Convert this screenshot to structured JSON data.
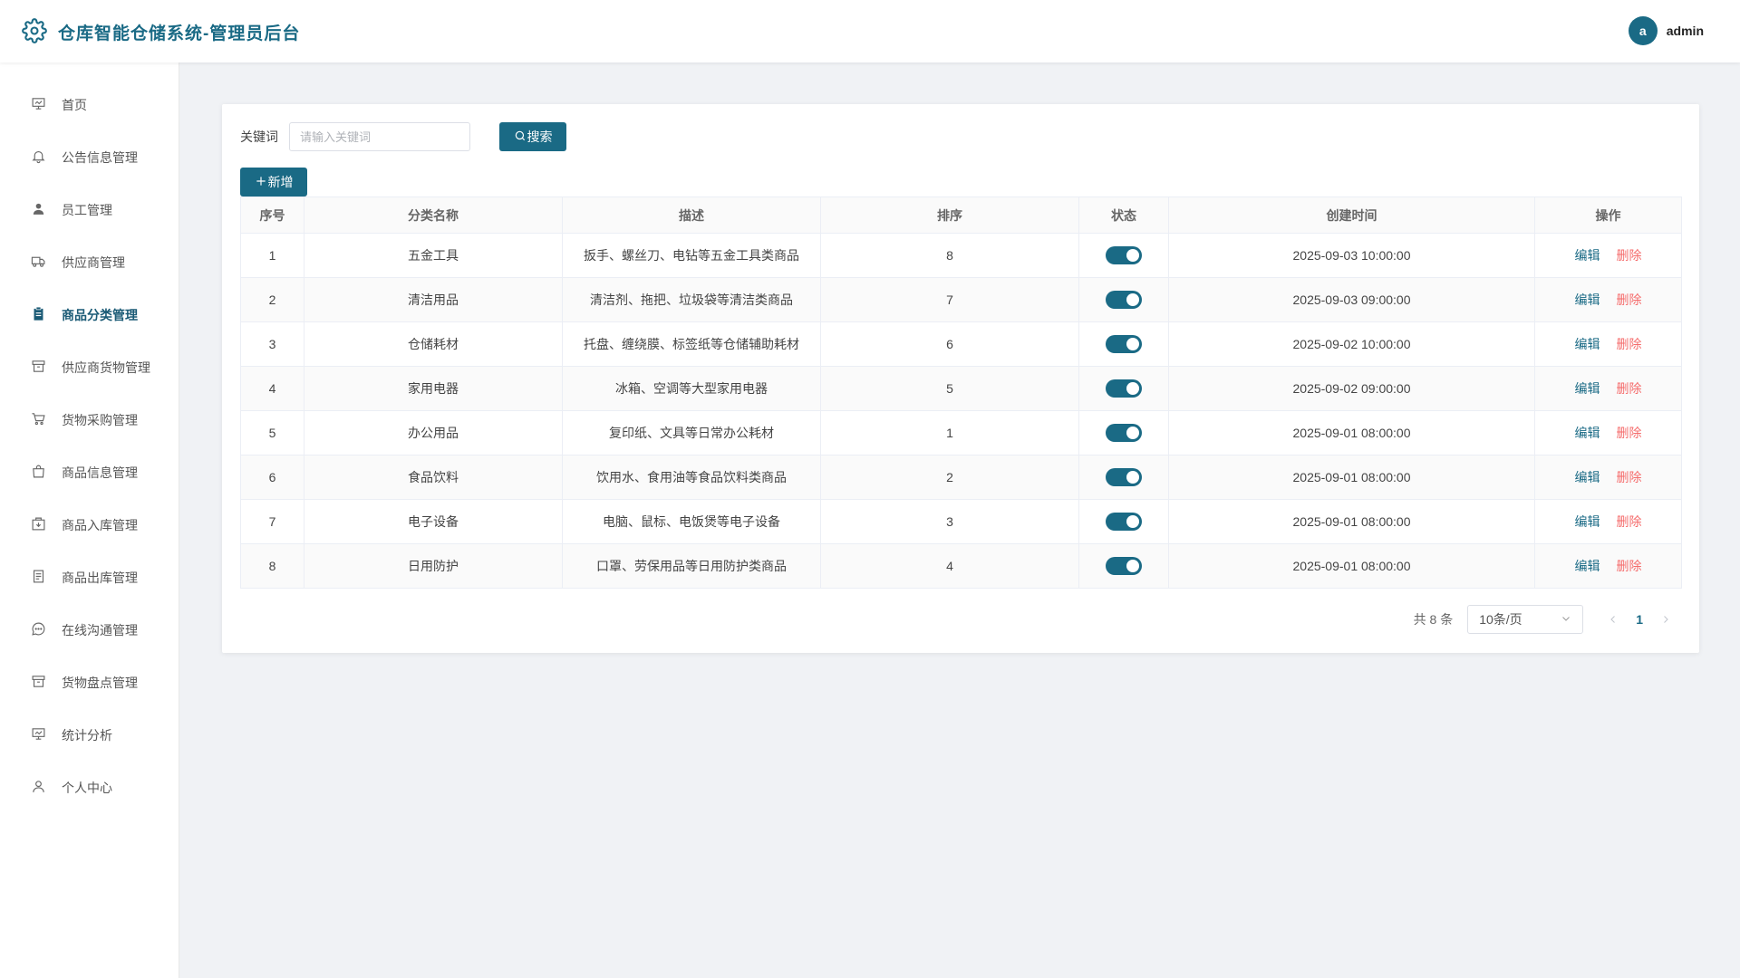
{
  "app": {
    "title": "仓库智能仓储系统-管理员后台",
    "accent": "#1a6a85"
  },
  "user": {
    "avatar_letter": "a",
    "name": "admin"
  },
  "sidebar": {
    "items": [
      {
        "label": "首页",
        "icon": "dashboard-icon",
        "active": false
      },
      {
        "label": "公告信息管理",
        "icon": "bell-icon",
        "active": false
      },
      {
        "label": "员工管理",
        "icon": "user-icon",
        "active": false
      },
      {
        "label": "供应商管理",
        "icon": "truck-icon",
        "active": false
      },
      {
        "label": "商品分类管理",
        "icon": "clipboard-icon",
        "active": true
      },
      {
        "label": "供应商货物管理",
        "icon": "box-icon",
        "active": false
      },
      {
        "label": "货物采购管理",
        "icon": "cart-icon",
        "active": false
      },
      {
        "label": "商品信息管理",
        "icon": "bag-icon",
        "active": false
      },
      {
        "label": "商品入库管理",
        "icon": "inbound-icon",
        "active": false
      },
      {
        "label": "商品出库管理",
        "icon": "document-icon",
        "active": false
      },
      {
        "label": "在线沟通管理",
        "icon": "chat-icon",
        "active": false
      },
      {
        "label": "货物盘点管理",
        "icon": "archive-icon",
        "active": false
      },
      {
        "label": "统计分析",
        "icon": "chart-icon",
        "active": false
      },
      {
        "label": "个人中心",
        "icon": "person-icon",
        "active": false
      }
    ]
  },
  "search": {
    "label": "关键词",
    "placeholder": "请输入关键词",
    "value": "",
    "button_label": "搜索"
  },
  "toolbar": {
    "add_label": "新增"
  },
  "table": {
    "columns": [
      "序号",
      "分类名称",
      "描述",
      "排序",
      "状态",
      "创建时间",
      "操作"
    ],
    "rows": [
      {
        "index": "1",
        "name": "五金工具",
        "desc": "扳手、螺丝刀、电钻等五金工具类商品",
        "sort": "8",
        "status": true,
        "created": "2025-09-03 10:00:00"
      },
      {
        "index": "2",
        "name": "清洁用品",
        "desc": "清洁剂、拖把、垃圾袋等清洁类商品",
        "sort": "7",
        "status": true,
        "created": "2025-09-03 09:00:00"
      },
      {
        "index": "3",
        "name": "仓储耗材",
        "desc": "托盘、缠绕膜、标签纸等仓储辅助耗材",
        "sort": "6",
        "status": true,
        "created": "2025-09-02 10:00:00"
      },
      {
        "index": "4",
        "name": "家用电器",
        "desc": "冰箱、空调等大型家用电器",
        "sort": "5",
        "status": true,
        "created": "2025-09-02 09:00:00"
      },
      {
        "index": "5",
        "name": "办公用品",
        "desc": "复印纸、文具等日常办公耗材",
        "sort": "1",
        "status": true,
        "created": "2025-09-01 08:00:00"
      },
      {
        "index": "6",
        "name": "食品饮料",
        "desc": "饮用水、食用油等食品饮料类商品",
        "sort": "2",
        "status": true,
        "created": "2025-09-01 08:00:00"
      },
      {
        "index": "7",
        "name": "电子设备",
        "desc": "电脑、鼠标、电饭煲等电子设备",
        "sort": "3",
        "status": true,
        "created": "2025-09-01 08:00:00"
      },
      {
        "index": "8",
        "name": "日用防护",
        "desc": "口罩、劳保用品等日用防护类商品",
        "sort": "4",
        "status": true,
        "created": "2025-09-01 08:00:00"
      }
    ],
    "edit_label": "编辑",
    "delete_label": "删除"
  },
  "pagination": {
    "total_text": "共 8 条",
    "page_size": "10条/页",
    "current_page": "1"
  }
}
